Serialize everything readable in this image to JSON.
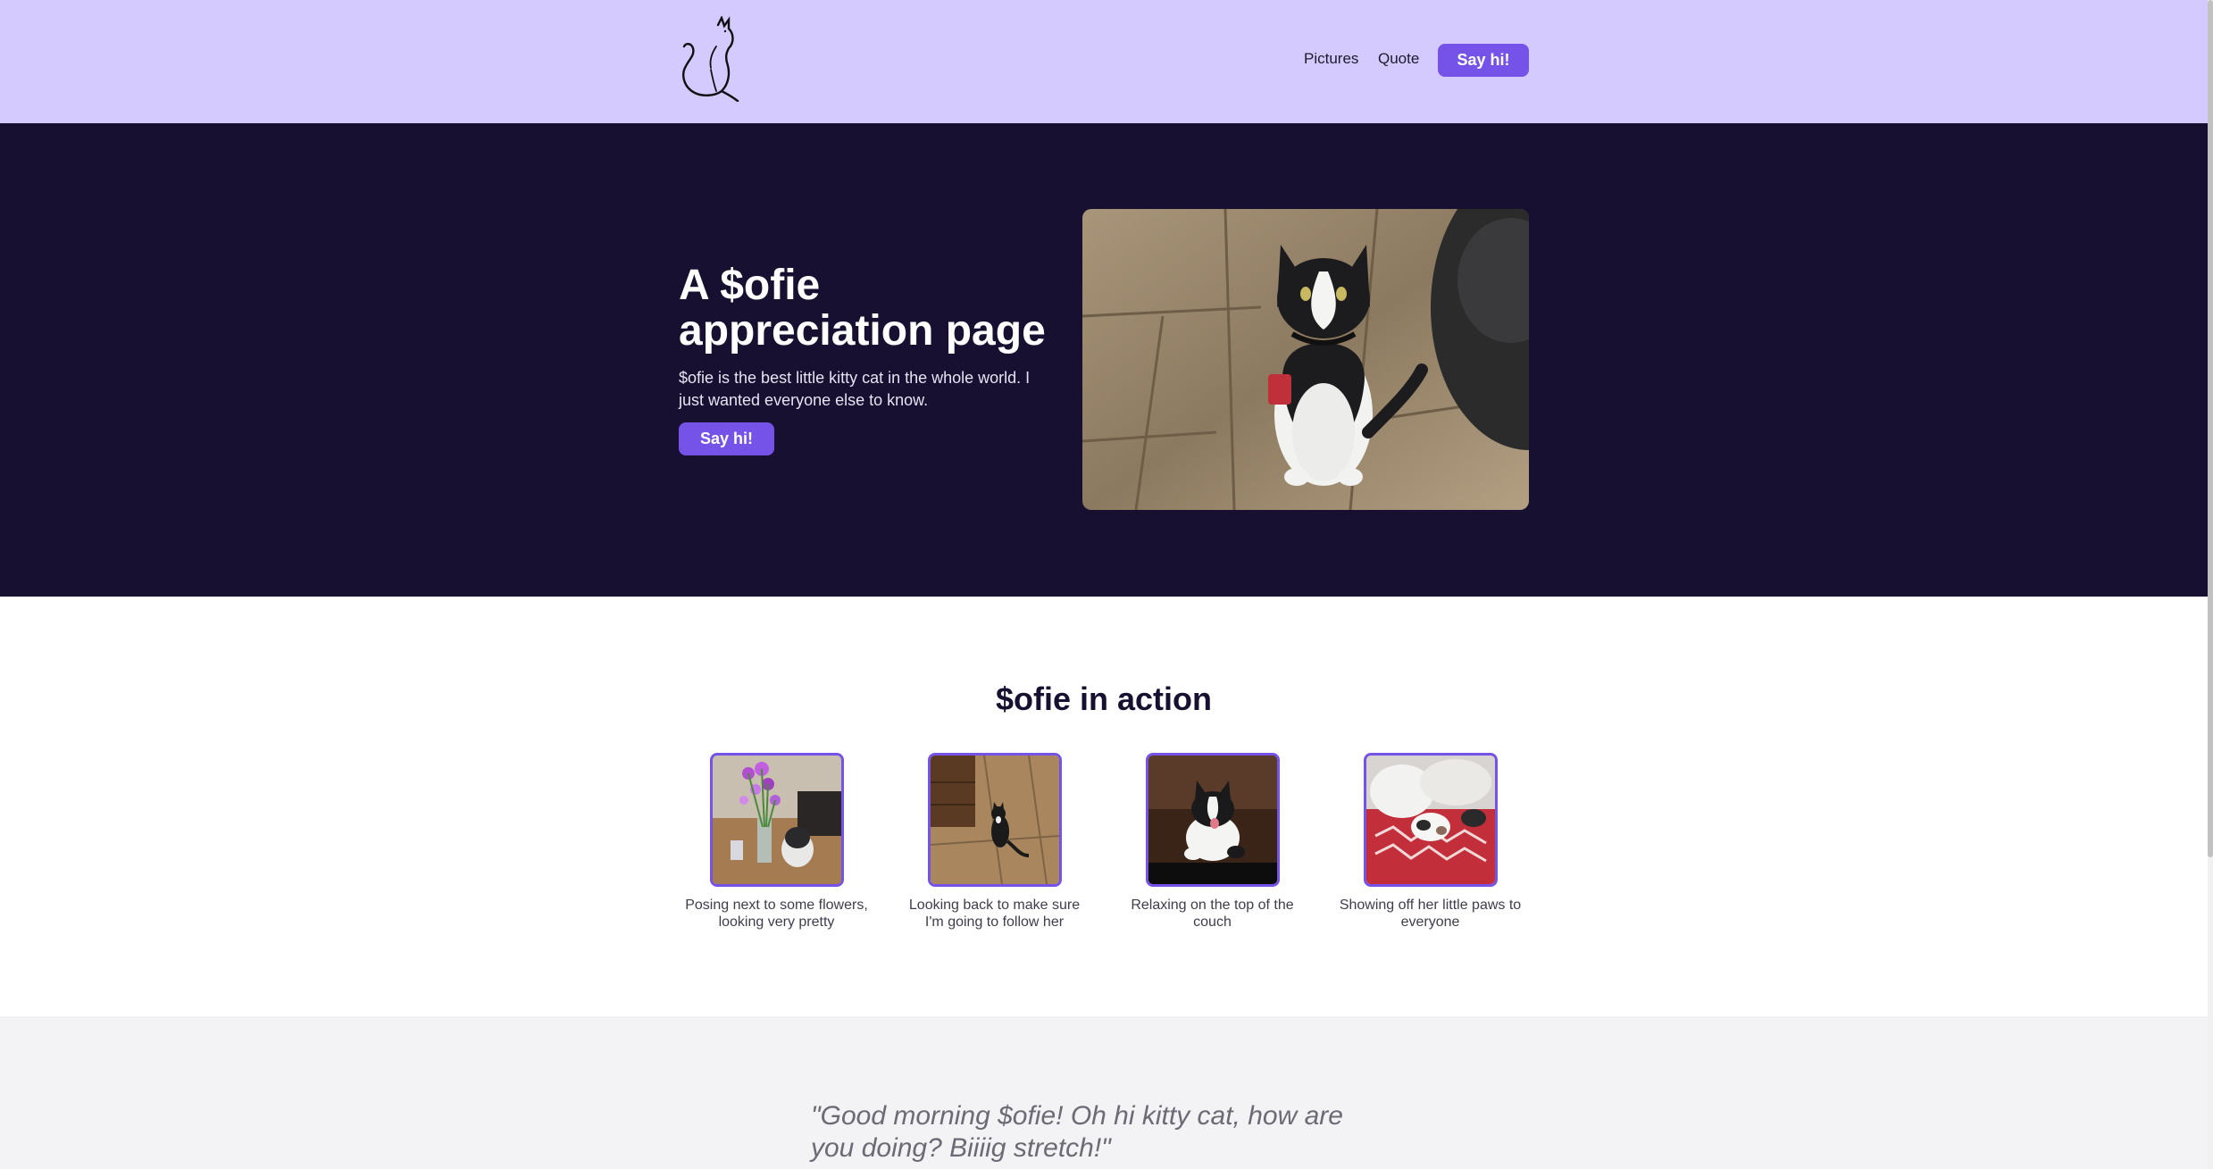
{
  "header": {
    "nav": [
      "Pictures",
      "Quote"
    ],
    "cta_label": "Say hi!",
    "logo_icon": "cat-silhouette-icon"
  },
  "hero": {
    "title": "A $ofie appreciation page",
    "description": "$ofie is the best little kitty cat in the whole world. I just wanted everyone else to know.",
    "cta_label": "Say hi!"
  },
  "gallery": {
    "title": "$ofie in action",
    "items": [
      {
        "caption": "Posing next to some flowers, looking very pretty"
      },
      {
        "caption": "Looking back to make sure I'm going to follow her"
      },
      {
        "caption": "Relaxing on the top of the couch"
      },
      {
        "caption": "Showing off her little paws to everyone"
      }
    ]
  },
  "quote": {
    "text": "\"Good morning $ofie! Oh hi kitty cat, how are you doing? Biiiig stretch!\""
  },
  "colors": {
    "header_bg": "#d4cafd",
    "hero_bg": "#171030",
    "accent": "#7552e8",
    "quote_bg": "#f3f3f5"
  }
}
